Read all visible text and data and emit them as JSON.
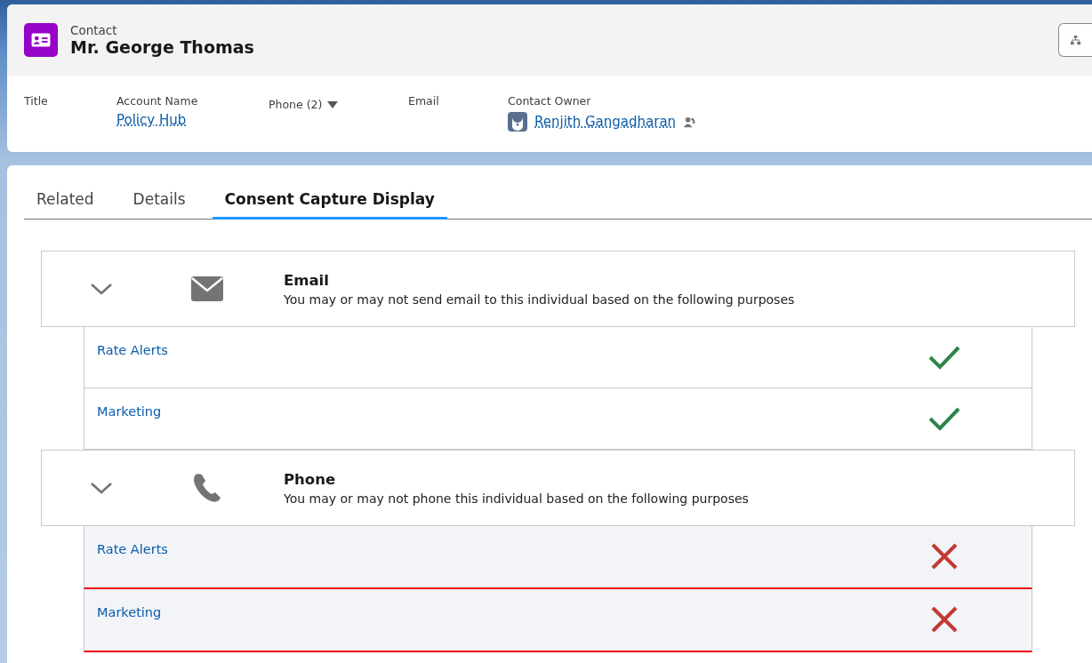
{
  "record": {
    "type": "Contact",
    "name": "Mr. George Thomas"
  },
  "fields": [
    {
      "label": "Title",
      "kind": "plain"
    },
    {
      "label": "Account Name",
      "kind": "link",
      "value": "Policy Hub"
    },
    {
      "label": "Phone (2)",
      "kind": "dropdown"
    },
    {
      "label": "Email",
      "kind": "plain"
    },
    {
      "label": "Contact Owner",
      "kind": "owner",
      "value": "Renjith Gangadharan"
    }
  ],
  "tabs": [
    {
      "label": "Related",
      "selected": false
    },
    {
      "label": "Details",
      "selected": false
    },
    {
      "label": "Consent Capture Display",
      "selected": true
    }
  ],
  "channels": [
    {
      "kind": "email",
      "title": "Email",
      "description": "You may or may not send email to this individual based on the following purposes",
      "expanded": true,
      "purposes": [
        {
          "name": "Rate Alerts",
          "granted": true
        },
        {
          "name": "Marketing",
          "granted": true
        }
      ]
    },
    {
      "kind": "phone",
      "title": "Phone",
      "description": "You may or may not phone this individual based on the following purposes",
      "expanded": true,
      "purposes": [
        {
          "name": "Rate Alerts",
          "granted": false
        },
        {
          "name": "Marketing",
          "granted": false
        }
      ]
    }
  ]
}
